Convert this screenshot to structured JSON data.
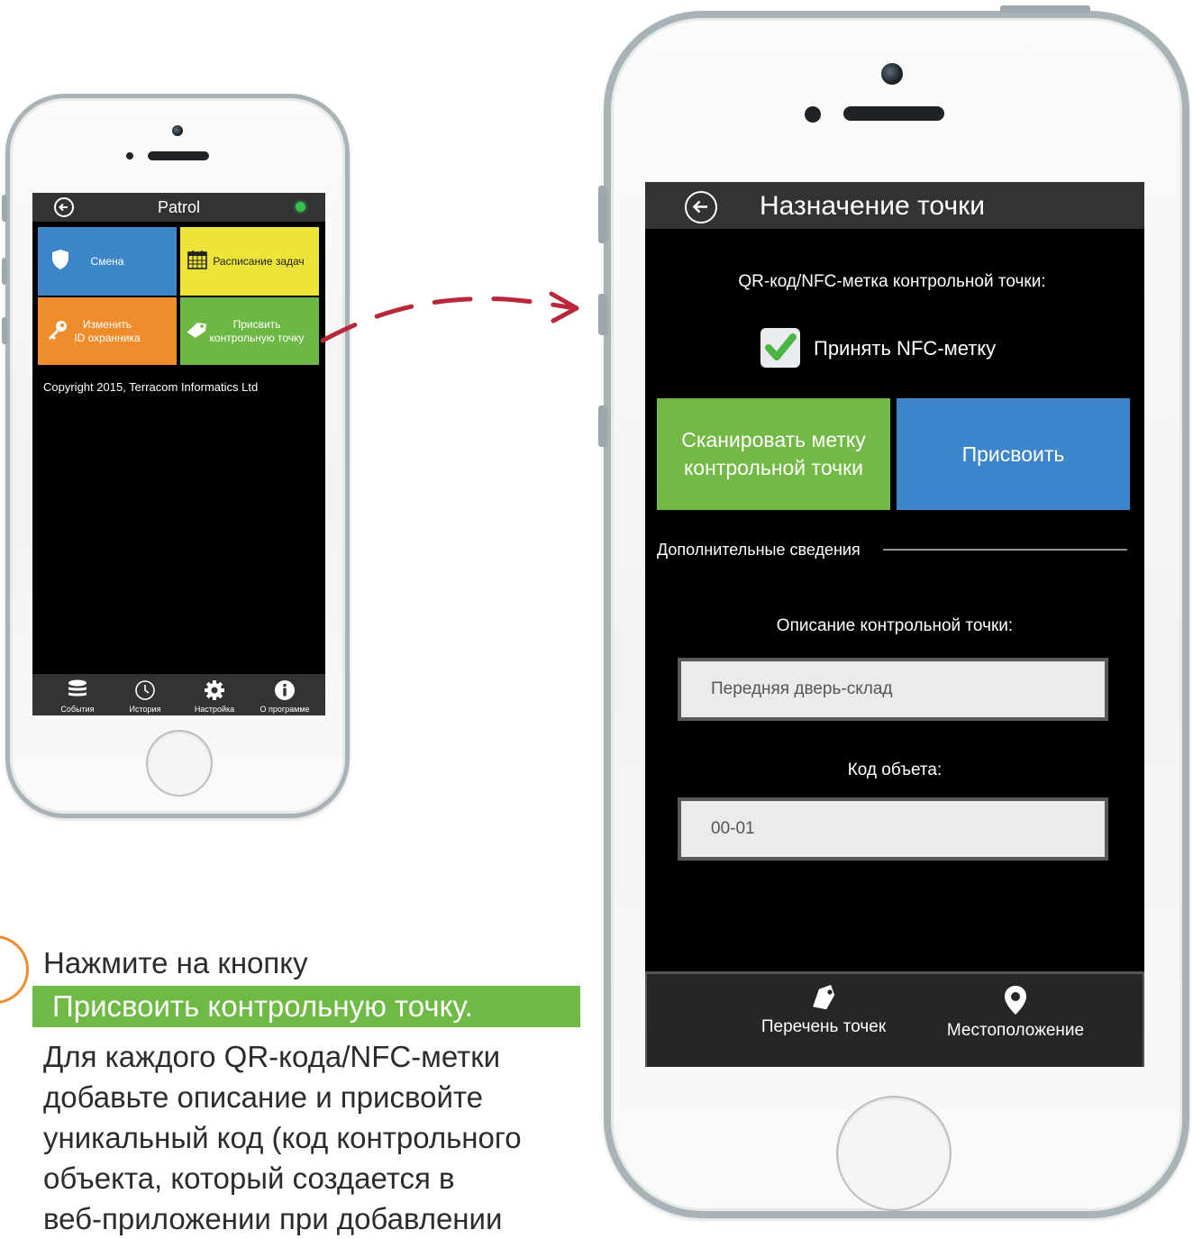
{
  "small_screen": {
    "header": {
      "title": "Patrol"
    },
    "tiles": {
      "shift": "Смена",
      "schedule": "Расписание задач",
      "change_id_line1": "Изменить",
      "change_id_line2": "ID охранника",
      "assign_line1": "Присвить",
      "assign_line2": "контрольную точку"
    },
    "copyright": "Copyright 2015, Terracom Informatics Ltd",
    "nav": {
      "events": "События",
      "history": "История",
      "settings": "Настройка",
      "about": "О программе"
    }
  },
  "big_screen": {
    "header": {
      "title": "Назначение точки"
    },
    "qr_label": "QR-код/NFC-метка контрольной точки:",
    "nfc_checkbox_label": "Принять NFC-метку",
    "nfc_checked": true,
    "scan_button_line1": "Сканировать метку",
    "scan_button_line2": "контрольной точки",
    "assign_button": "Присвоить",
    "section_title": "Дополнительные сведения",
    "description_label": "Описание контрольной точки:",
    "description_value": "Передняя дверь-склад",
    "object_code_label": "Код объета:",
    "object_code_value": "00-01",
    "nav": {
      "points_list": "Перечень точек",
      "location": "Местоположение"
    }
  },
  "instructions": {
    "line1": "Нажмите на кнопку",
    "highlight": "Присвоить контрольную точку.",
    "rest_line1": "Для каждого QR-кода/NFC-метки",
    "rest_line2": "добавьте описание и присвойте",
    "rest_line3": "уникальный код (код контрольного",
    "rest_line4": "объекта, который создается в",
    "rest_line5": "веб-приложении при добавлении"
  },
  "colors": {
    "blue": "#3c86c9",
    "yellow": "#ede43a",
    "orange": "#ef8d2c",
    "green": "#6db845",
    "arrow": "#b8283a",
    "status_dot": "#33c14d"
  },
  "icons": [
    "back-arrow-icon",
    "status-dot-icon",
    "shield-icon",
    "calendar-icon",
    "key-icon",
    "tag-icon",
    "database-icon",
    "clock-icon",
    "gear-icon",
    "info-icon",
    "checkmark-icon",
    "map-pin-icon"
  ]
}
